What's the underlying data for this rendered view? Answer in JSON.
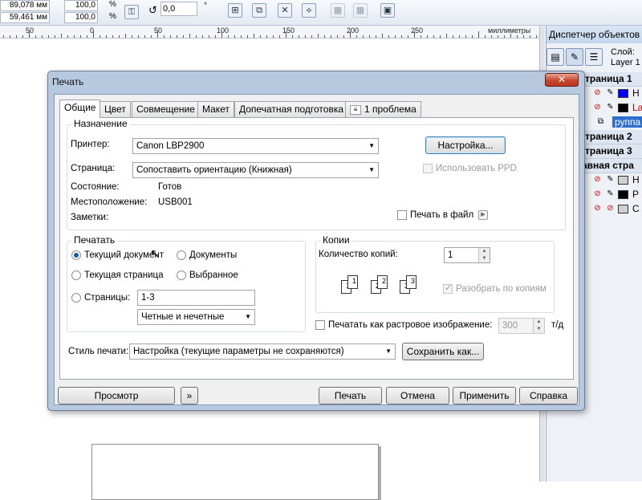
{
  "toolbar": {
    "coord_x": "89,078 мм",
    "coord_y": "59,461 мм",
    "scale_x": "100,0",
    "scale_y": "100,0",
    "percent": "%",
    "rotation": "0,0",
    "degree": "°"
  },
  "ruler": {
    "unit": "миллиметры",
    "labels": [
      "50",
      "0",
      "50",
      "100",
      "150",
      "200",
      "250"
    ]
  },
  "docker": {
    "title": "Диспетчер объектов",
    "layer_caption": "Слой:",
    "layer_name": "Layer 1",
    "rows": [
      {
        "text": "траница 1"
      },
      {
        "text": "Н",
        "color": "#0000ff"
      },
      {
        "text": "La",
        "color": "#000000",
        "red": true
      },
      {
        "text": "руппа"
      },
      {
        "text": "траница 2"
      },
      {
        "text": "траница 3"
      },
      {
        "text": "авная стра"
      },
      {
        "text": "Н",
        "color": "#d0d0d0"
      },
      {
        "text": "Р",
        "color": "#000000"
      },
      {
        "text": "С",
        "color": "#d0d0d0"
      }
    ]
  },
  "dialog": {
    "title": "Печать",
    "close": "✕",
    "tabs": [
      "Общие",
      "Цвет",
      "Совмещение",
      "Макет",
      "Допечатная подготовка",
      "1 проблема"
    ],
    "destination": {
      "title": "Назначение",
      "printer_label": "Принтер:",
      "printer_value": "Canon LBP2900",
      "page_label": "Страница:",
      "page_value": "Сопоставить ориентацию (Книжная)",
      "status_label": "Состояние:",
      "status_value": "Готов",
      "location_label": "Местоположение:",
      "location_value": "USB001",
      "notes_label": "Заметки:",
      "settings_button": "Настройка...",
      "use_ppd": "Использовать PPD",
      "print_to_file": "Печать в файл"
    },
    "print_range": {
      "title": "Печатать",
      "current_doc": "Текущий документ",
      "documents": "Документы",
      "current_page": "Текущая страница",
      "selection": "Выбранное",
      "pages": "Страницы:",
      "pages_value": "1-3",
      "odd_even": "Четные и нечетные"
    },
    "copies": {
      "title": "Копии",
      "count_label": "Количество копий:",
      "count_value": "1",
      "collate": "Разобрать по копиям"
    },
    "raster": {
      "label": "Печатать как растровое изображение:",
      "dpi": "300",
      "unit": "т/д"
    },
    "style": {
      "label": "Стиль печати:",
      "value": "Настройка (текущие параметры не сохраняются)",
      "save_as": "Сохранить как..."
    },
    "buttons": {
      "preview": "Просмотр",
      "print": "Печать",
      "cancel": "Отмена",
      "apply": "Применить",
      "help": "Справка"
    }
  }
}
